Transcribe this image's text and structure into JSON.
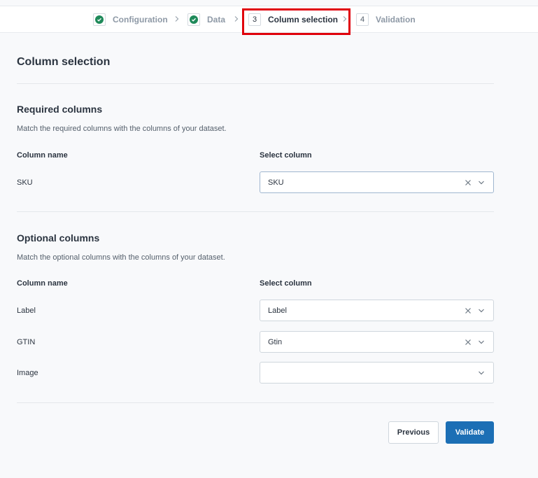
{
  "stepper": {
    "steps": [
      {
        "number": "",
        "label": "Configuration",
        "state": "done"
      },
      {
        "number": "",
        "label": "Data",
        "state": "done"
      },
      {
        "number": "3",
        "label": "Column selection",
        "state": "active"
      },
      {
        "number": "4",
        "label": "Validation",
        "state": "pending"
      }
    ]
  },
  "page": {
    "title": "Column selection"
  },
  "required": {
    "title": "Required columns",
    "description": "Match the required columns with the columns of your dataset.",
    "col_name_header": "Column name",
    "select_header": "Select column",
    "rows": [
      {
        "label": "SKU",
        "value": "SKU"
      }
    ]
  },
  "optional": {
    "title": "Optional columns",
    "description": "Match the optional columns with the columns of your dataset.",
    "col_name_header": "Column name",
    "select_header": "Select column",
    "rows": [
      {
        "label": "Label",
        "value": "Label"
      },
      {
        "label": "GTIN",
        "value": "Gtin"
      },
      {
        "label": "Image",
        "value": ""
      }
    ]
  },
  "actions": {
    "previous_label": "Previous",
    "validate_label": "Validate"
  },
  "colors": {
    "accent": "#1c6fb5",
    "success": "#1f8a5a",
    "highlight": "#e0000b"
  }
}
